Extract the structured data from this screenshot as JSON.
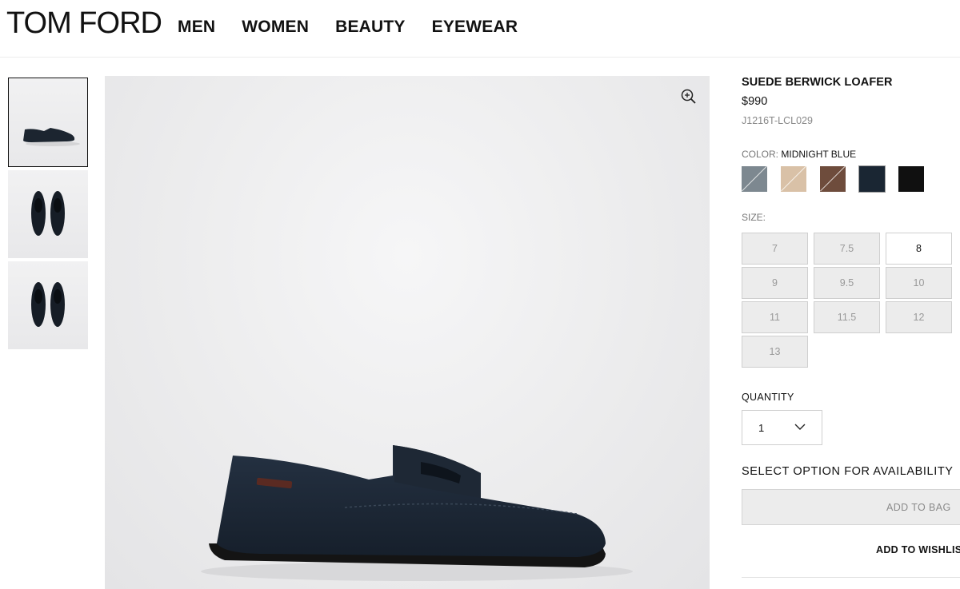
{
  "header": {
    "logo": "TOM FORD",
    "nav": [
      "MEN",
      "WOMEN",
      "BEAUTY",
      "EYEWEAR"
    ]
  },
  "gallery": {
    "thumbnails": [
      "side-view",
      "top-view",
      "top-view"
    ],
    "selected_index": 0,
    "zoom_icon": "zoom-in-icon"
  },
  "product": {
    "title": "SUEDE BERWICK LOAFER",
    "price": "$990",
    "sku": "J1216T-LCL029",
    "color_label": "COLOR:",
    "color_value": "MIDNIGHT BLUE",
    "swatches": [
      {
        "color": "#7d8890",
        "unavailable": true
      },
      {
        "color": "#d9c1a7",
        "unavailable": true
      },
      {
        "color": "#6e4c3c",
        "unavailable": true
      },
      {
        "color": "#1a2633",
        "unavailable": false,
        "selected": true
      },
      {
        "color": "#101010",
        "unavailable": false
      }
    ],
    "size_label": "SIZE:",
    "sizes": [
      {
        "label": "7",
        "available": false
      },
      {
        "label": "7.5",
        "available": false
      },
      {
        "label": "8",
        "available": true
      },
      {
        "label": "9",
        "available": false
      },
      {
        "label": "9.5",
        "available": false
      },
      {
        "label": "10",
        "available": false
      },
      {
        "label": "11",
        "available": false
      },
      {
        "label": "11.5",
        "available": false
      },
      {
        "label": "12",
        "available": false
      },
      {
        "label": "13",
        "available": false
      }
    ],
    "quantity_label": "QUANTITY",
    "quantity_value": "1",
    "availability_text": "SELECT OPTION FOR AVAILABILITY",
    "add_to_bag": "ADD TO BAG",
    "add_to_wishlist": "ADD TO WISHLIST"
  },
  "colors": {
    "text": "#111111",
    "muted": "#888888",
    "disabled_bg": "#ececec",
    "border": "#cfcfcf"
  }
}
